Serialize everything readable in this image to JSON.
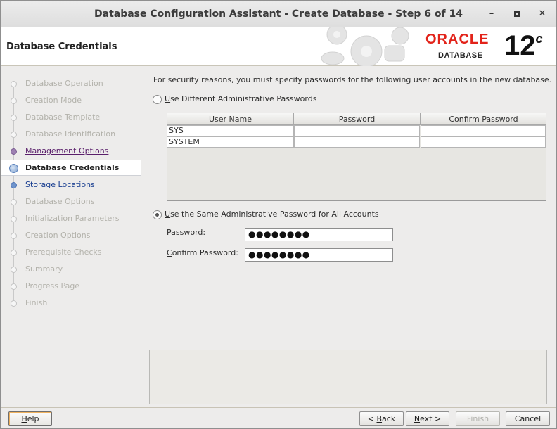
{
  "window": {
    "title": "Database Configuration Assistant - Create Database - Step 6 of 14"
  },
  "header": {
    "page_title": "Database Credentials",
    "logo_word": "ORACLE",
    "logo_sub": "DATABASE",
    "version_num": "12",
    "version_sup": "c"
  },
  "sidebar": {
    "steps": [
      {
        "label": "Database Operation",
        "state": "disabled"
      },
      {
        "label": "Creation Mode",
        "state": "disabled"
      },
      {
        "label": "Database Template",
        "state": "disabled"
      },
      {
        "label": "Database Identification",
        "state": "disabled"
      },
      {
        "label": "Management Options",
        "state": "visited"
      },
      {
        "label": "Database Credentials",
        "state": "current"
      },
      {
        "label": "Storage Locations",
        "state": "link"
      },
      {
        "label": "Database Options",
        "state": "disabled"
      },
      {
        "label": "Initialization Parameters",
        "state": "disabled"
      },
      {
        "label": "Creation Options",
        "state": "disabled"
      },
      {
        "label": "Prerequisite Checks",
        "state": "disabled"
      },
      {
        "label": "Summary",
        "state": "disabled"
      },
      {
        "label": "Progress Page",
        "state": "disabled"
      },
      {
        "label": "Finish",
        "state": "disabled"
      }
    ]
  },
  "main": {
    "intro": "For security reasons, you must specify passwords for the following user accounts in the new database.",
    "option_different": {
      "mnemonic": "U",
      "rest": "se Different Administrative Passwords",
      "selected": false
    },
    "table": {
      "headers": [
        "User Name",
        "Password",
        "Confirm Password"
      ],
      "rows": [
        {
          "user": "SYS",
          "password": "",
          "confirm": ""
        },
        {
          "user": "SYSTEM",
          "password": "",
          "confirm": ""
        }
      ]
    },
    "option_same": {
      "mnemonic": "U",
      "rest": "se the Same Administrative Password for All Accounts",
      "selected": true
    },
    "password_label_m": "P",
    "password_label_rest": "assword:",
    "password_value": "●●●●●●●●",
    "confirm_label_m": "C",
    "confirm_label_rest": "onfirm Password:",
    "confirm_value": "●●●●●●●●"
  },
  "buttons": {
    "help_m": "H",
    "help_rest": "elp",
    "back_pre": "< ",
    "back_m": "B",
    "back_rest": "ack",
    "next_m": "N",
    "next_rest": "ext >",
    "finish": "Finish",
    "cancel": "Cancel"
  }
}
